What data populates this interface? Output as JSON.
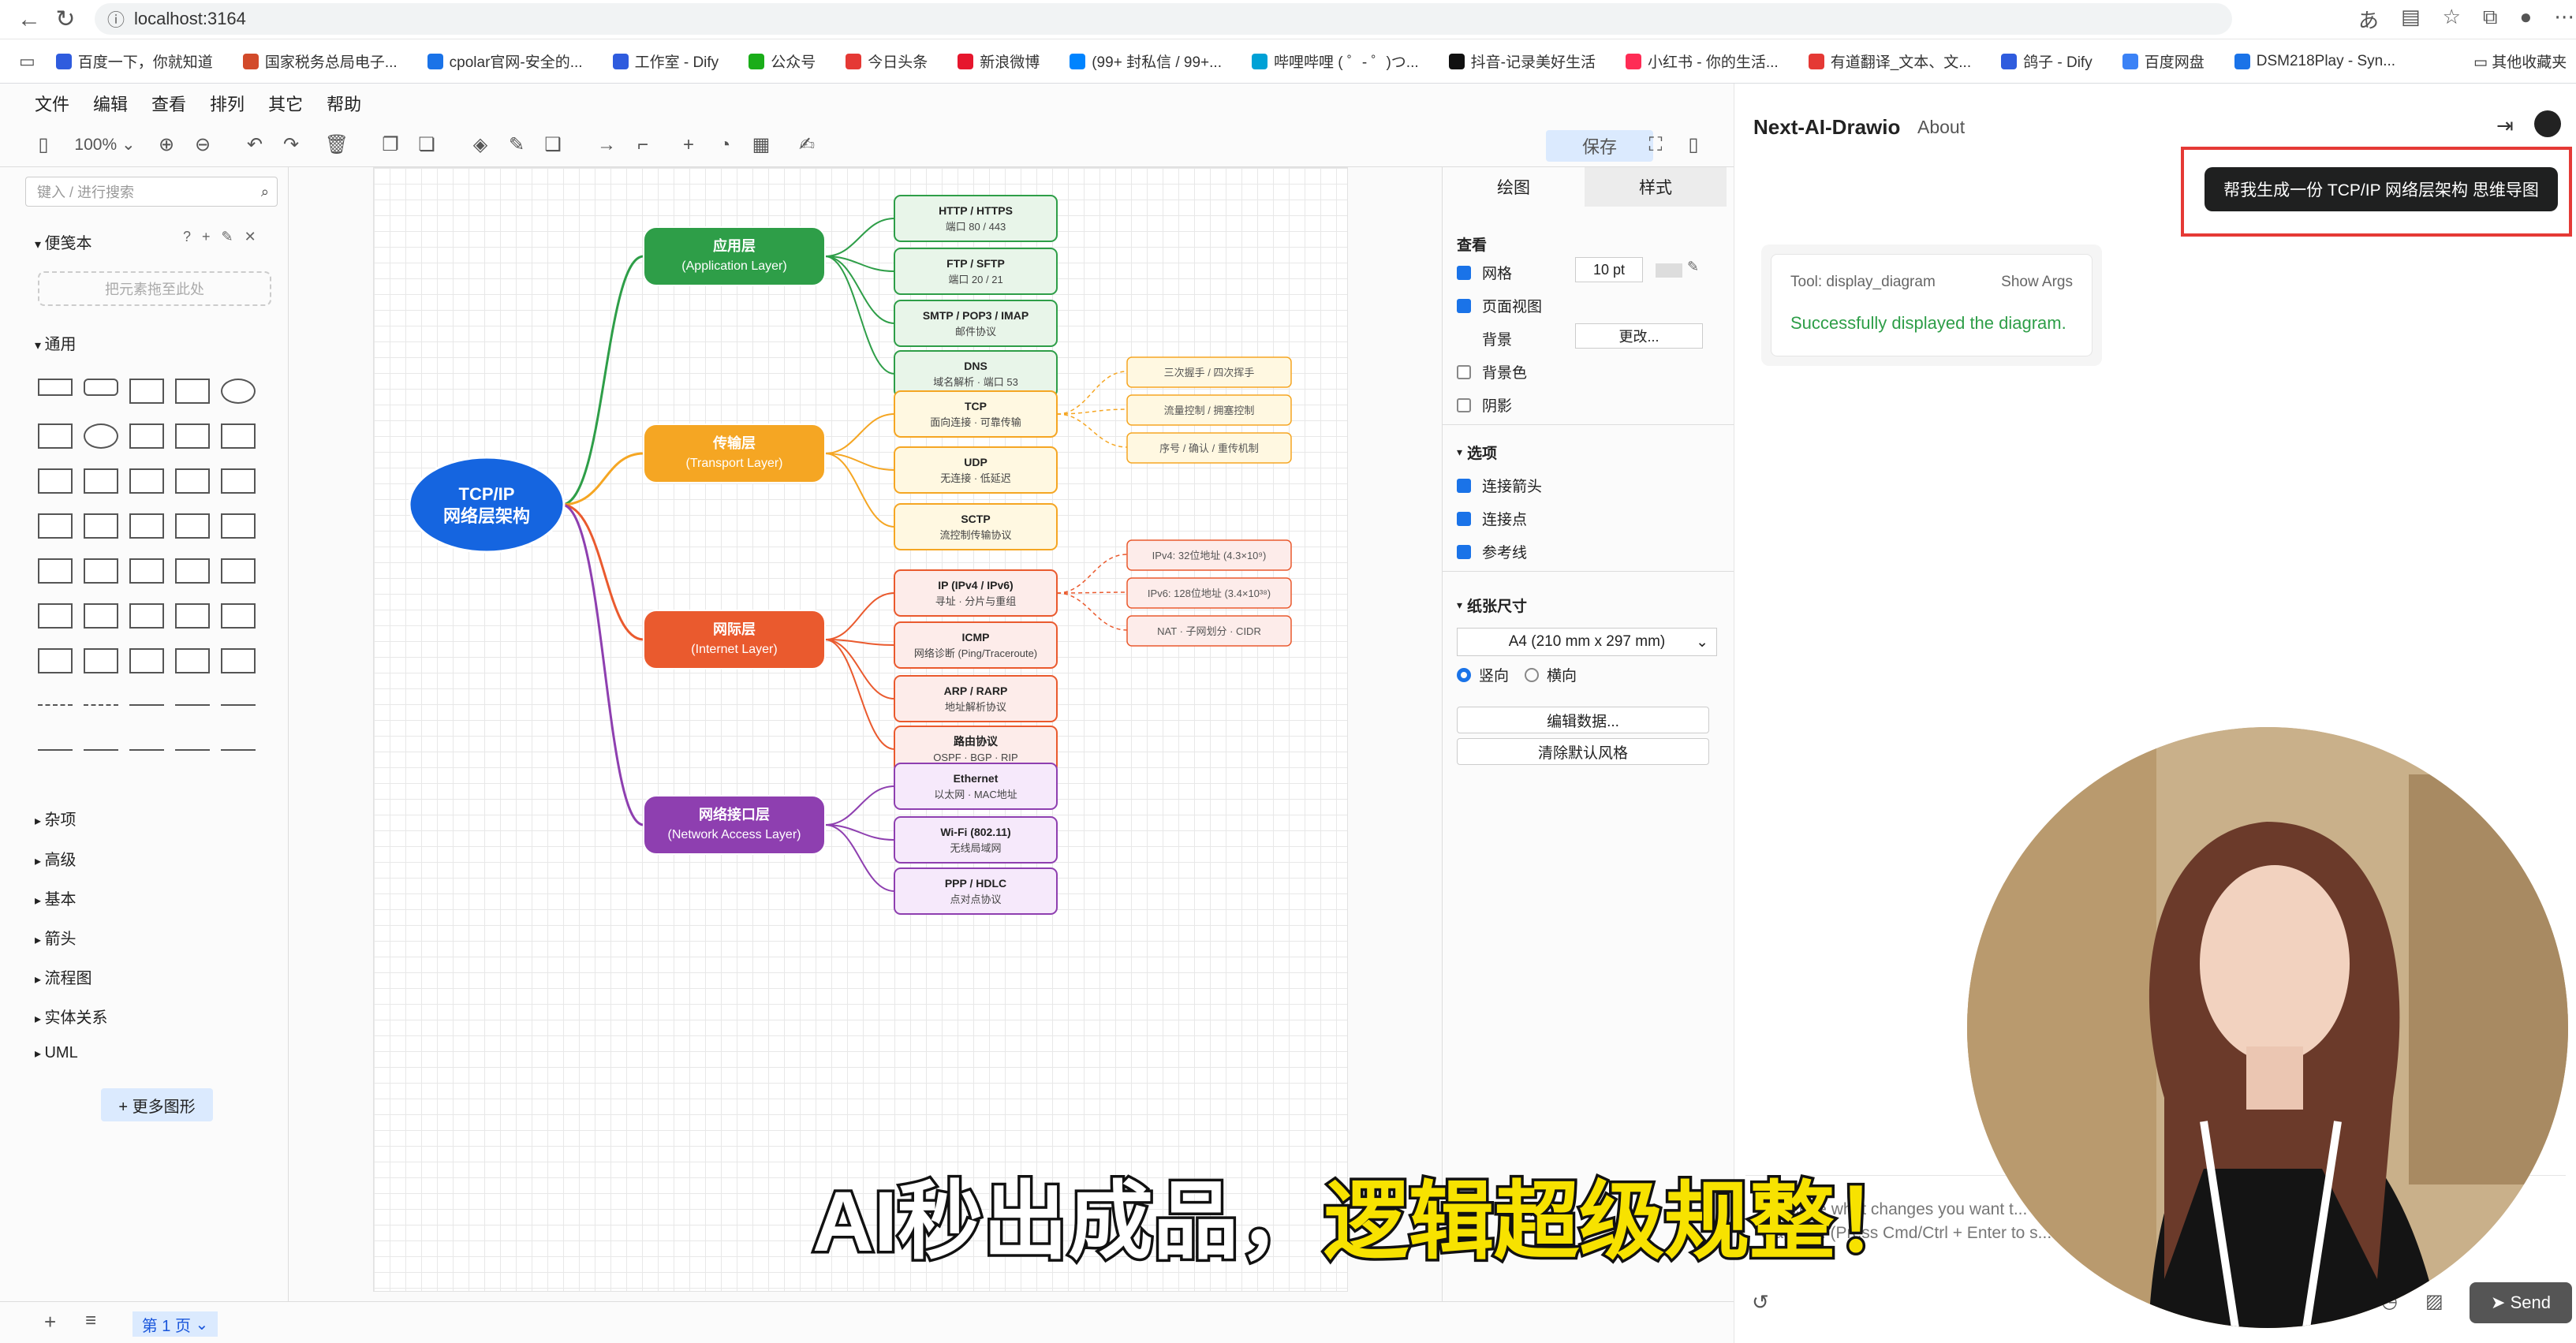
{
  "browser": {
    "url": "localhost:3164",
    "bookmarks": [
      "百度一下，你就知道",
      "国家税务总局电子...",
      "cpolar官网-安全的...",
      "工作室 - Dify",
      "公众号",
      "今日头条",
      "新浪微博",
      "(99+ 封私信 / 99+...",
      "哔哩哔哩 ( ゜- ゜)つ...",
      "抖音-记录美好生活",
      "小红书 - 你的生活...",
      "有道翻译_文本、文...",
      "鸽子 - Dify",
      "百度网盘",
      "DSM218Play - Syn..."
    ],
    "bookmark_colors": [
      "#2f5cde",
      "#d24a2a",
      "#1a73e8",
      "#2f5cde",
      "#1aad19",
      "#e53935",
      "#e6162d",
      "#0084ff",
      "#00a1d6",
      "#111111",
      "#fe2c55",
      "#e53935",
      "#2f5cde",
      "#3b82f6",
      "#1a73e8"
    ],
    "other_bookmarks": "其他收藏夹"
  },
  "menu": [
    "文件",
    "编辑",
    "查看",
    "排列",
    "其它",
    "帮助"
  ],
  "toolbar": {
    "zoom": "100%",
    "save_label": "保存"
  },
  "left_panel": {
    "search_placeholder": "键入 / 进行搜索",
    "scratchpad": "便笺本",
    "scratch_drop": "把元素拖至此处",
    "general": "通用",
    "sections": [
      "杂项",
      "高级",
      "基本",
      "箭头",
      "流程图",
      "实体关系",
      "UML"
    ],
    "more_shapes": "+ 更多图形"
  },
  "right_panel": {
    "tab_draw": "绘图",
    "tab_style": "样式",
    "view_title": "查看",
    "grid": "网格",
    "grid_size": "10 pt",
    "page_view": "页面视图",
    "background": "背景",
    "change": "更改...",
    "bg_color": "背景色",
    "shadow": "阴影",
    "options_title": "选项",
    "connection_arrows": "连接箭头",
    "connection_points": "连接点",
    "guides": "参考线",
    "paper_size_title": "纸张尺寸",
    "paper_size": "A4 (210 mm x 297 mm)",
    "portrait": "竖向",
    "landscape": "横向",
    "edit_data": "编辑数据...",
    "clear_style": "清除默认风格"
  },
  "bottom": {
    "page_tab": "第 1 页"
  },
  "diagram": {
    "root": [
      "TCP/IP",
      "网络层架构"
    ],
    "layers": [
      {
        "title": "应用层",
        "en": "(Application Layer)",
        "color": "#2e9e48",
        "light": "#e8f5e9",
        "items": [
          [
            "HTTP / HTTPS",
            "端口 80 / 443"
          ],
          [
            "FTP / SFTP",
            "端口 20 / 21"
          ],
          [
            "SMTP / POP3 / IMAP",
            "邮件协议"
          ],
          [
            "DNS",
            "域名解析 · 端口 53"
          ]
        ],
        "notes": []
      },
      {
        "title": "传输层",
        "en": "(Transport Layer)",
        "color": "#f5a623",
        "light": "#fff8e1",
        "items": [
          [
            "TCP",
            "面向连接 · 可靠传输"
          ],
          [
            "UDP",
            "无连接 · 低延迟"
          ],
          [
            "SCTP",
            "流控制传输协议"
          ]
        ],
        "notes": [
          "三次握手 / 四次挥手",
          "流量控制 / 拥塞控制",
          "序号 / 确认 / 重传机制"
        ]
      },
      {
        "title": "网际层",
        "en": "(Internet Layer)",
        "color": "#ea5a2e",
        "light": "#fdecea",
        "items": [
          [
            "IP (IPv4 / IPv6)",
            "寻址 · 分片与重组"
          ],
          [
            "ICMP",
            "网络诊断 (Ping/Traceroute)"
          ],
          [
            "ARP / RARP",
            "地址解析协议"
          ],
          [
            "路由协议",
            "OSPF · BGP · RIP"
          ]
        ],
        "notes": [
          "IPv4: 32位地址 (4.3×10⁹)",
          "IPv6: 128位地址 (3.4×10³⁸)",
          "NAT · 子网划分 · CIDR"
        ]
      },
      {
        "title": "网络接口层",
        "en": "(Network Access Layer)",
        "color": "#8e3fb0",
        "light": "#f6e9fb",
        "items": [
          [
            "Ethernet",
            "以太网 · MAC地址"
          ],
          [
            "Wi-Fi (802.11)",
            "无线局域网"
          ],
          [
            "PPP / HDLC",
            "点对点协议"
          ]
        ],
        "notes": []
      }
    ]
  },
  "chat": {
    "title": "Next-AI-Drawio",
    "about": "About",
    "user_message": "帮我生成一份 TCP/IP 网络层架构 思维导图",
    "tool_name": "Tool: display_diagram",
    "show_args": "Show Args",
    "tool_result": "Successfully displayed the diagram.",
    "placeholder": "Describe what changes you want t... diagram. (Press Cmd/Ctrl + Enter to s...",
    "send": "Send"
  },
  "subtitle": {
    "part1": "AI秒出成品，",
    "part2": "逻辑超级规整！"
  }
}
